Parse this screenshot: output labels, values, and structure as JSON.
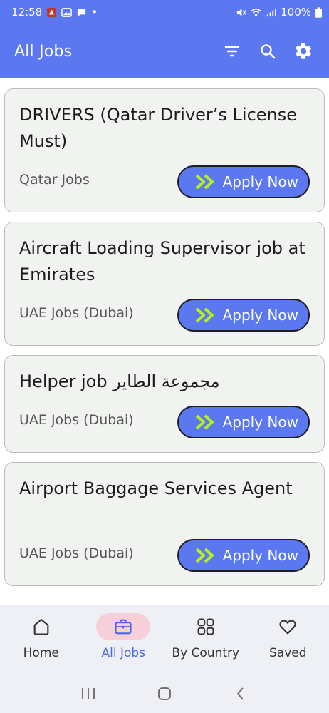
{
  "status_bar": {
    "time": "12:58",
    "battery": "100%",
    "dot": "•"
  },
  "app_bar": {
    "title": "All Jobs",
    "icons": [
      "filter-icon",
      "search-icon",
      "gear-icon"
    ]
  },
  "jobs": [
    {
      "title": "DRIVERS (Qatar Driver’s License Must)",
      "location": "Qatar Jobs",
      "apply_label": "Apply Now"
    },
    {
      "title": "Aircraft Loading Supervisor job at Emirates",
      "location": "UAE Jobs (Dubai)",
      "apply_label": "Apply Now"
    },
    {
      "title": "Helper job مجموعة الطاير",
      "location": "UAE Jobs (Dubai)",
      "apply_label": "Apply Now"
    },
    {
      "title": "Airport Baggage Services Agent",
      "location": "UAE Jobs (Dubai)",
      "apply_label": "Apply Now"
    }
  ],
  "bottom_nav": {
    "items": [
      {
        "label": "Home",
        "icon": "home-icon",
        "active": false
      },
      {
        "label": "All Jobs",
        "icon": "briefcase-icon",
        "active": true
      },
      {
        "label": "By Country",
        "icon": "grid-icon",
        "active": false
      },
      {
        "label": "Saved",
        "icon": "heart-icon",
        "active": false
      }
    ]
  },
  "colors": {
    "primary": "#5b78f0",
    "card_bg": "#f1f3f1",
    "chevron": "#b6f01e",
    "active_pill": "#f6cfd8",
    "active_label": "#4a68e6"
  }
}
